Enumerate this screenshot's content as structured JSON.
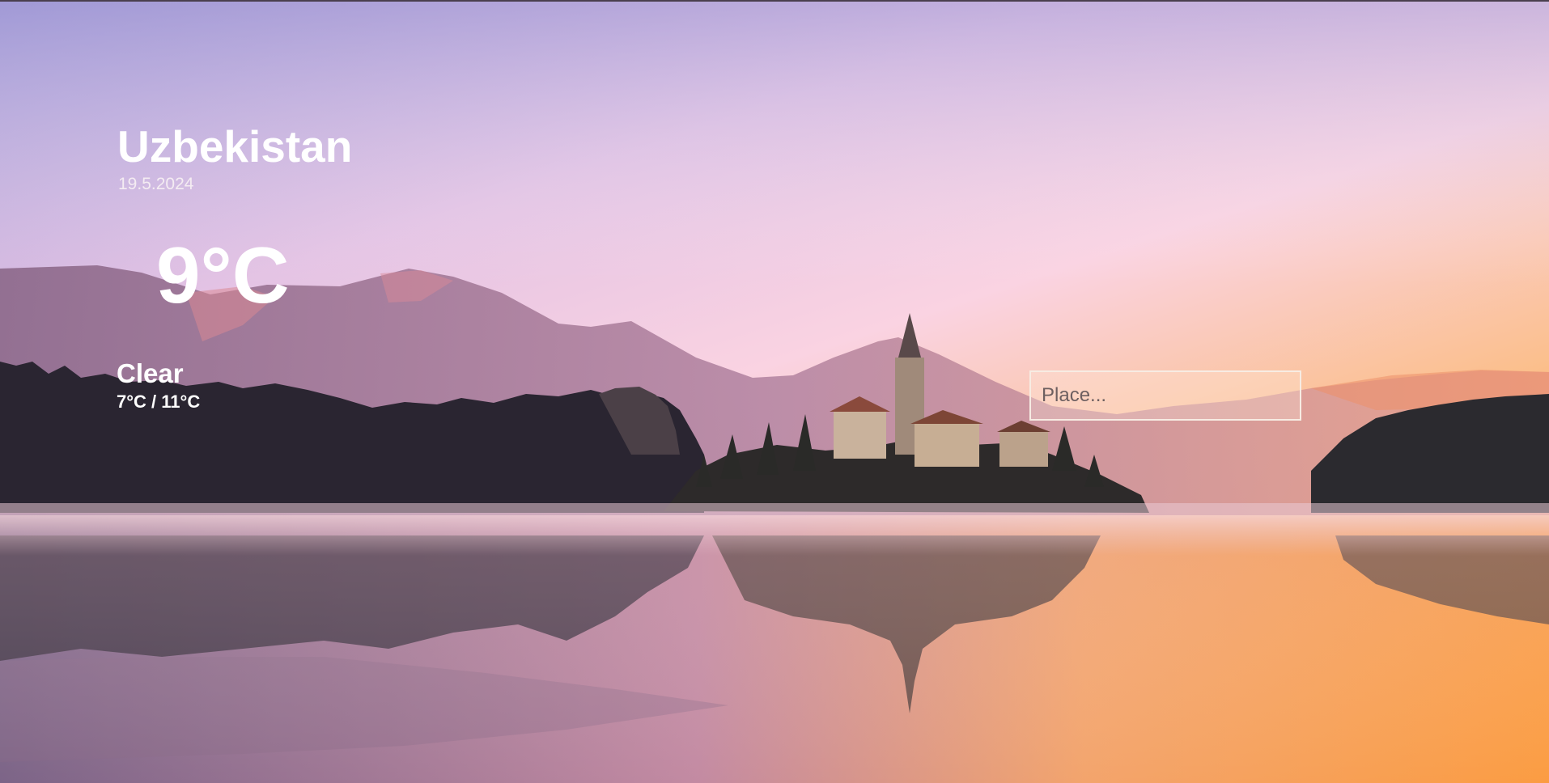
{
  "weather": {
    "location": "Uzbekistan",
    "date": "19.5.2024",
    "temperature": "9°C",
    "condition": "Clear",
    "range": "7°C / 11°C"
  },
  "search": {
    "placeholder": "Place...",
    "value": ""
  },
  "background": {
    "scene": "sunrise-lake-church-island",
    "sky_top": "#b4a2d8",
    "sky_mid": "#fbd6e6",
    "sky_horizon": "#fcb46c",
    "water": "#f4a35f"
  }
}
